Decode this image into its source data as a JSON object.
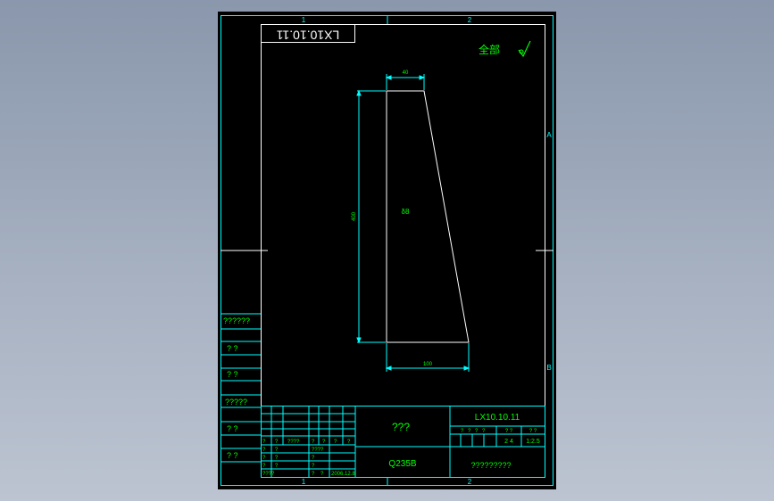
{
  "drawing": {
    "code_mirrored": "LX10.10.11",
    "roughness_label": "全部",
    "grid": {
      "col_top_1": "1",
      "col_top_2": "2",
      "col_bottom_1": "1",
      "col_bottom_2": "2",
      "row_a": "A",
      "row_b": "B"
    },
    "dimensions": {
      "top_width": "40",
      "height": "400",
      "bottom_width": "100",
      "thickness": "δ8"
    }
  },
  "side_table": {
    "rows": [
      "??????",
      "?  ?",
      "?  ?",
      "?????",
      "?  ?",
      "?  ?"
    ]
  },
  "title_block": {
    "part_name": "???",
    "material": "Q235B",
    "drawing_number": "LX10.10.11",
    "company": "?????????",
    "small_labels": {
      "row_a": [
        "?",
        "?",
        "????",
        "?",
        "?",
        "?",
        "?"
      ],
      "row_b": [
        "?",
        "?",
        "????"
      ],
      "row_c": [
        "?",
        "?",
        "?"
      ],
      "row_d": [
        "?",
        "?",
        "?"
      ],
      "row_e": [
        "????",
        "?",
        "?"
      ],
      "date": "2006.12.8"
    },
    "stage_header": [
      "?",
      "?",
      "?",
      "?"
    ],
    "weight_header": "?  ?",
    "scale_header": "?  ?",
    "stage_count": "2 4",
    "scale": "1:2.5"
  },
  "colors": {
    "frame": "#00ffff",
    "geometry": "#ffffff",
    "text": "#00ff00",
    "background": "#000000"
  }
}
